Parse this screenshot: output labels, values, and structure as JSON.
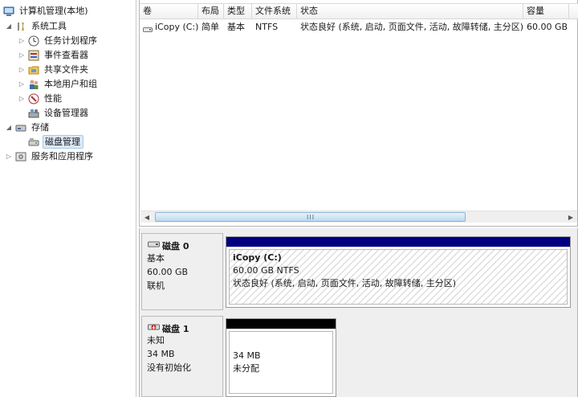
{
  "tree": {
    "root": "计算机管理(本地)",
    "items": [
      {
        "label": "系统工具",
        "icon": "tools-icon"
      },
      {
        "label": "任务计划程序",
        "icon": "clock-icon"
      },
      {
        "label": "事件查看器",
        "icon": "event-viewer-icon"
      },
      {
        "label": "共享文件夹",
        "icon": "shared-folder-icon"
      },
      {
        "label": "本地用户和组",
        "icon": "users-icon"
      },
      {
        "label": "性能",
        "icon": "performance-icon"
      },
      {
        "label": "设备管理器",
        "icon": "device-manager-icon"
      },
      {
        "label": "存储",
        "icon": "storage-icon"
      },
      {
        "label": "磁盘管理",
        "icon": "disk-management-icon"
      },
      {
        "label": "服务和应用程序",
        "icon": "services-icon"
      }
    ]
  },
  "volume_list": {
    "columns": [
      "卷",
      "布局",
      "类型",
      "文件系统",
      "状态",
      "容量"
    ],
    "rows": [
      [
        "iCopy (C:)",
        "简单",
        "基本",
        "NTFS",
        "状态良好 (系统, 启动, 页面文件, 活动, 故障转储, 主分区)",
        "60.00 GB"
      ]
    ],
    "scroll_grip": "III"
  },
  "disks": [
    {
      "title": "磁盘 0",
      "kind": "基本",
      "size": "60.00 GB",
      "status": "联机",
      "partition": {
        "name": "iCopy  (C:)",
        "detail": "60.00 GB NTFS",
        "status": "状态良好 (系统, 启动, 页面文件, 活动, 故障转储, 主分区)",
        "bar_color": "#000080"
      }
    },
    {
      "title": "磁盘 1",
      "kind": "未知",
      "size": "34 MB",
      "status": "没有初始化",
      "partition": {
        "size": "34 MB",
        "state": "未分配",
        "bar_color": "#000000"
      }
    }
  ]
}
